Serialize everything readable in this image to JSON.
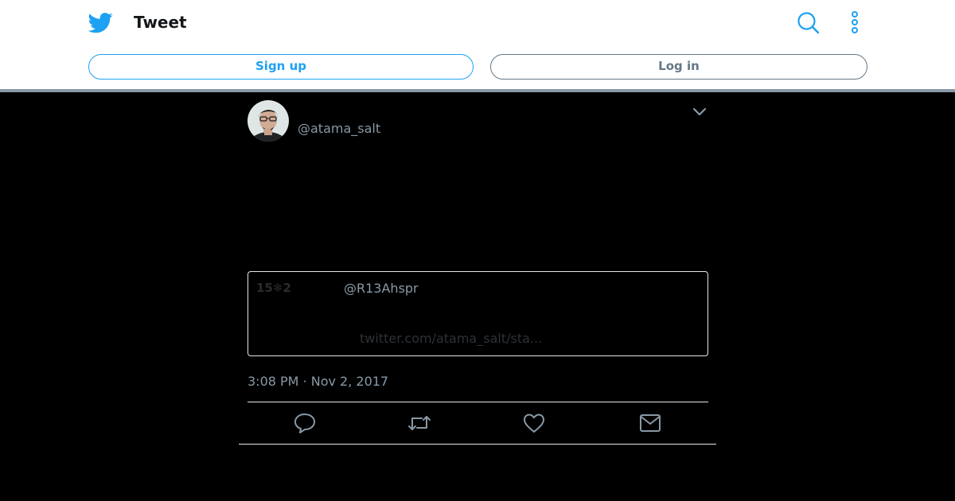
{
  "header": {
    "title": "Tweet",
    "signup_label": "Sign up",
    "login_label": "Log in",
    "icons": {
      "logo": "twitter-bird-icon",
      "search": "search-icon",
      "more": "more-vertical-icon"
    }
  },
  "tweet": {
    "handle": "@atama_salt",
    "quote": {
      "name": "15❄︎2",
      "handle": "@R13Ahspr",
      "link": "twitter.com/atama_salt/sta..."
    },
    "timestamp": "3:08 PM · Nov 2, 2017",
    "actions": [
      "reply-icon",
      "retweet-icon",
      "like-icon",
      "direct-message-icon"
    ]
  },
  "colors": {
    "brand_blue": "#1da1f2",
    "secondary_text": "#8899a6",
    "background": "#000000"
  }
}
